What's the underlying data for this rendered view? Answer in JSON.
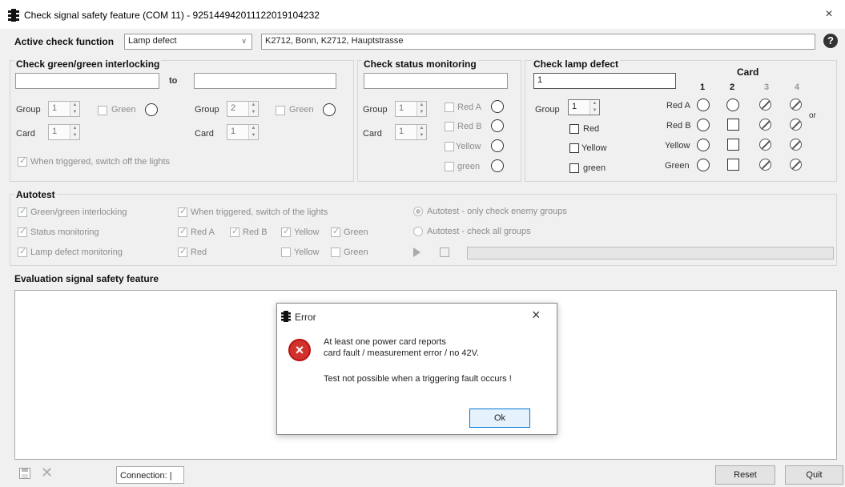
{
  "window": {
    "title": "Check signal safety feature (COM 11) - 925144942011122019104232",
    "close": "×"
  },
  "active": {
    "label": "Active check function",
    "select_value": "Lamp defect",
    "location": "K2712, Bonn, K2712, Hauptstrasse",
    "help": "?"
  },
  "gg": {
    "title": "Check green/green interlocking",
    "to": "to",
    "group_label": "Group",
    "card_label": "Card",
    "left_group": "1",
    "left_card": "1",
    "right_group": "2",
    "right_card": "1",
    "green_label": "Green",
    "switch_off": "When triggered, switch off the lights"
  },
  "status": {
    "title": "Check status monitoring",
    "group_label": "Group",
    "card_label": "Card",
    "group": "1",
    "card": "1",
    "lamps": [
      "Red A",
      "Red B",
      "Yellow",
      "green"
    ]
  },
  "lamp": {
    "title": "Check lamp defect",
    "input": "1",
    "group_label": "Group",
    "group": "1",
    "checks": [
      "Red",
      "Yellow",
      "green"
    ],
    "card_title": "Card",
    "cards": [
      "1",
      "2",
      "3",
      "4"
    ],
    "rows": [
      "Red A",
      "Red B",
      "Yellow",
      "Green"
    ],
    "or": "or"
  },
  "autotest": {
    "title": "Autotest",
    "col1": [
      "Green/green interlocking",
      "Status monitoring",
      "Lamp defect monitoring"
    ],
    "switch": "When triggered, switch of the lights",
    "red_a": "Red A",
    "red_b": "Red B",
    "yellow": "Yellow",
    "green": "Green",
    "red": "Red",
    "radio1": "Autotest - only check enemy groups",
    "radio2": "Autotest - check all groups"
  },
  "eval": {
    "title": "Evaluation signal safety feature"
  },
  "dialog": {
    "title": "Error",
    "close": "×",
    "line1": "At least one power card reports",
    "line2": "card fault / measurement error / no 42V.",
    "line3": "Test not possible when a triggering fault occurs !",
    "ok": "Ok",
    "icon": "×"
  },
  "bottom": {
    "connection": "Connection:",
    "reset": "Reset",
    "quit": "Quit"
  },
  "colors": {
    "error": "#d2322d",
    "background": "#f0f0f0"
  }
}
